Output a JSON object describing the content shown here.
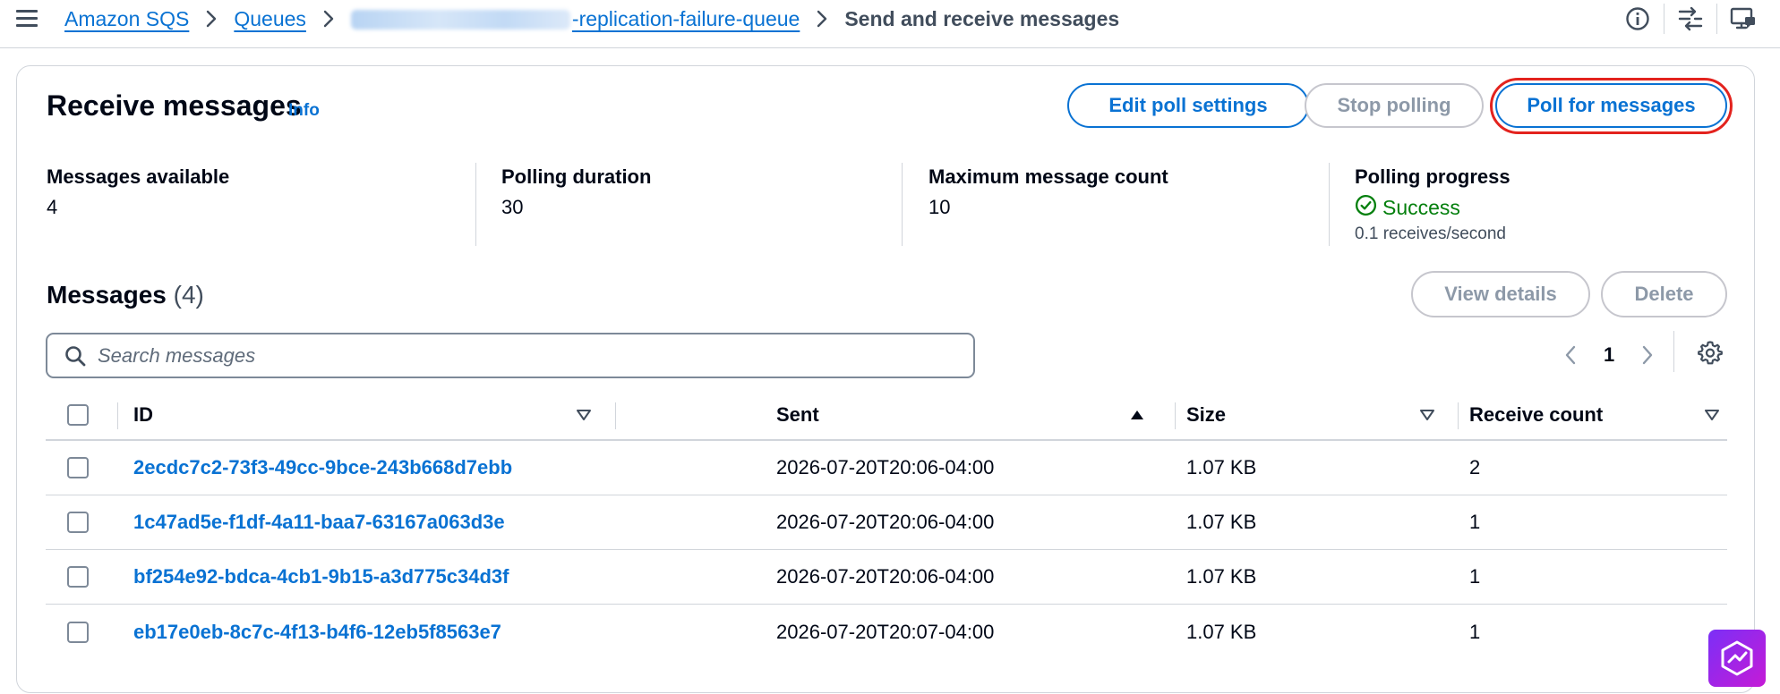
{
  "breadcrumb": {
    "items": [
      "Amazon SQS",
      "Queues",
      "-replication-failure-queue"
    ],
    "current": "Send and receive messages"
  },
  "receive": {
    "title": "Receive messages",
    "info_label": "Info",
    "buttons": {
      "edit_poll": "Edit poll settings",
      "stop_polling": "Stop polling",
      "poll": "Poll for messages"
    },
    "stats": {
      "messages_available_label": "Messages available",
      "messages_available_value": "4",
      "polling_duration_label": "Polling duration",
      "polling_duration_value": "30",
      "max_count_label": "Maximum message count",
      "max_count_value": "10",
      "progress_label": "Polling progress",
      "progress_status": "Success",
      "progress_rate": "0.1 receives/second"
    }
  },
  "messages": {
    "title": "Messages",
    "count_text": "(4)",
    "view_details": "View details",
    "delete": "Delete",
    "search_placeholder": "Search messages",
    "page": "1",
    "columns": [
      "ID",
      "Sent",
      "Size",
      "Receive count"
    ],
    "rows": [
      {
        "id": "2ecdc7c2-73f3-49cc-9bce-243b668d7ebb",
        "sent": "2026-07-20T20:06-04:00",
        "size": "1.07 KB",
        "receive_count": "2"
      },
      {
        "id": "1c47ad5e-f1df-4a11-baa7-63167a063d3e",
        "sent": "2026-07-20T20:06-04:00",
        "size": "1.07 KB",
        "receive_count": "1"
      },
      {
        "id": "bf254e92-bdca-4cb1-9b15-a3d775c34d3f",
        "sent": "2026-07-20T20:06-04:00",
        "size": "1.07 KB",
        "receive_count": "1"
      },
      {
        "id": "eb17e0eb-8c7c-4f13-b4f6-12eb5f8563e7",
        "sent": "2026-07-20T20:07-04:00",
        "size": "1.07 KB",
        "receive_count": "1"
      }
    ]
  },
  "colors": {
    "link": "#0972d3",
    "success": "#037f0c",
    "highlight": "#e3231e",
    "border": "#d1d5db",
    "disabled": "#8d99a8"
  },
  "icons": {
    "menu": "hamburger-icon",
    "info": "info-circle-icon",
    "compare": "arrows-compare-icon",
    "feedback": "monitor-chat-icon",
    "search": "search-icon",
    "success": "check-circle-icon",
    "settings": "gear-icon",
    "sort_desc": "caret-down-icon",
    "sort_asc": "caret-up-icon"
  }
}
